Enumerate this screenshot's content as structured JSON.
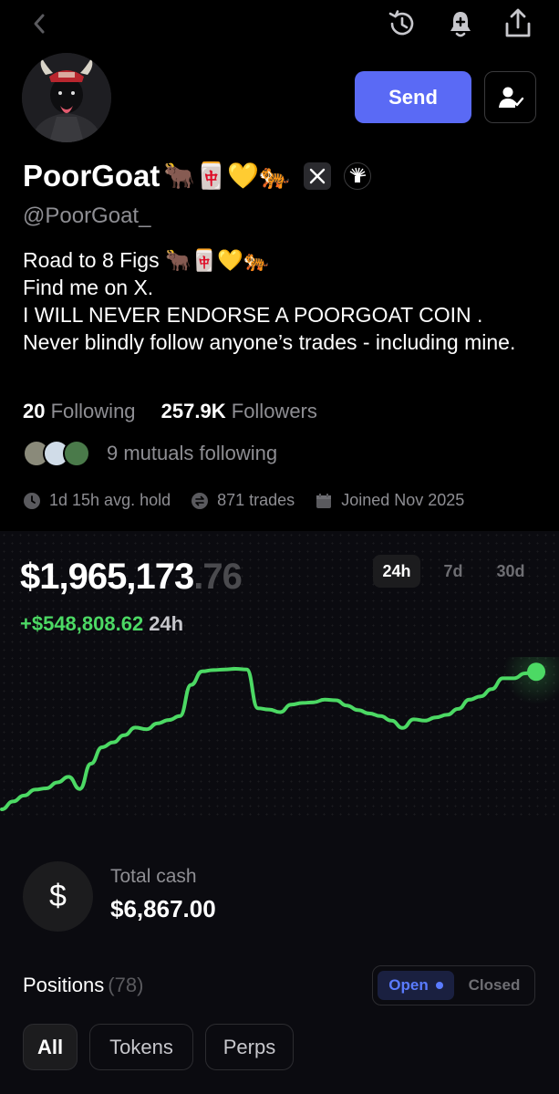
{
  "header": {
    "back_icon": "chevron-left-icon",
    "history_icon": "history-icon",
    "notify_icon": "bell-plus-icon",
    "share_icon": "share-icon"
  },
  "profile": {
    "send_label": "Send",
    "name": "PoorGoat",
    "name_emojis": "🐂🀄💛🐅",
    "handle": "@PoorGoat_",
    "bio": [
      "Road to 8 Figs 🐂🀄💛🐅",
      "Find me on X.",
      "I WILL NEVER ENDORSE A POORGOAT COIN .",
      "Never blindly follow anyone’s trades - including mine."
    ],
    "following_count": "20",
    "following_label": "Following",
    "followers_count": "257.9K",
    "followers_label": "Followers",
    "mutuals_text": "9 mutuals following",
    "avg_hold": "1d 15h avg. hold",
    "trades": "871 trades",
    "joined": "Joined Nov 2025"
  },
  "portfolio": {
    "balance_main": "$1,965,173",
    "balance_cents": ".76",
    "change_value": "+$548,808.62",
    "change_period": "24h",
    "timeframes": [
      "24h",
      "7d",
      "30d"
    ],
    "active_timeframe": "24h",
    "cash_symbol": "$",
    "cash_label": "Total cash",
    "cash_value": "$6,867.00"
  },
  "positions": {
    "title": "Positions",
    "count": "(78)",
    "open_label": "Open",
    "closed_label": "Closed",
    "filters": [
      "All",
      "Tokens",
      "Perps"
    ]
  },
  "colors": {
    "accent": "#5a6af5",
    "positive": "#4cd964",
    "muted": "#8e8e93"
  },
  "chart_data": {
    "type": "line",
    "title": "",
    "xlabel": "",
    "ylabel": "",
    "grid": false,
    "x": [
      0,
      1,
      2,
      3,
      4,
      5,
      6,
      7,
      8,
      9,
      10,
      11,
      12,
      13,
      14,
      15,
      16,
      17,
      18,
      19,
      20,
      21,
      22,
      23,
      24,
      25,
      26,
      27,
      28,
      29,
      30,
      31,
      32,
      33,
      34,
      35,
      36,
      37,
      38,
      39,
      40,
      41,
      42,
      43,
      44,
      45,
      46,
      47,
      48
    ],
    "values": [
      1416,
      1440,
      1458,
      1476,
      1480,
      1498,
      1515,
      1478,
      1555,
      1605,
      1620,
      1642,
      1665,
      1660,
      1678,
      1688,
      1700,
      1795,
      1836,
      1840,
      1842,
      1844,
      1842,
      1724,
      1720,
      1712,
      1735,
      1740,
      1742,
      1750,
      1748,
      1732,
      1718,
      1708,
      1700,
      1686,
      1664,
      1690,
      1686,
      1696,
      1704,
      1722,
      1750,
      1760,
      1782,
      1815,
      1815,
      1830,
      1835
    ],
    "ylim": [
      1380,
      1880
    ]
  }
}
